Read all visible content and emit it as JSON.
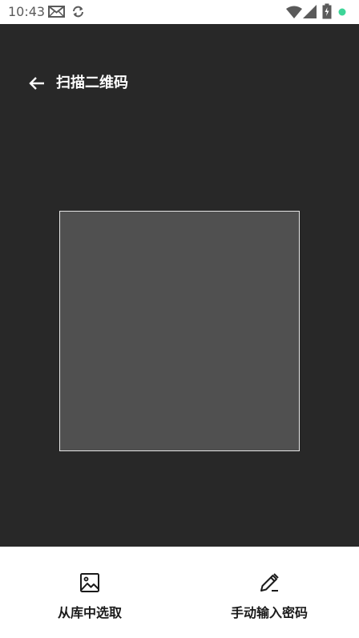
{
  "status_bar": {
    "time": "10:43",
    "icons": [
      "mail-icon",
      "sync-icon",
      "wifi-icon",
      "signal-icon",
      "battery-icon",
      "notification-dot-icon"
    ],
    "dot_color": "#3dd598"
  },
  "header": {
    "back_icon": "arrow-left-icon",
    "title": "扫描二维码"
  },
  "colors": {
    "scanner_background": "#282828",
    "scan_frame_fill": "#505050",
    "scan_frame_border": "#e6e6e6"
  },
  "actions": [
    {
      "icon": "image-icon",
      "label": "从库中选取"
    },
    {
      "icon": "pencil-icon",
      "label": "手动输入密码"
    }
  ]
}
